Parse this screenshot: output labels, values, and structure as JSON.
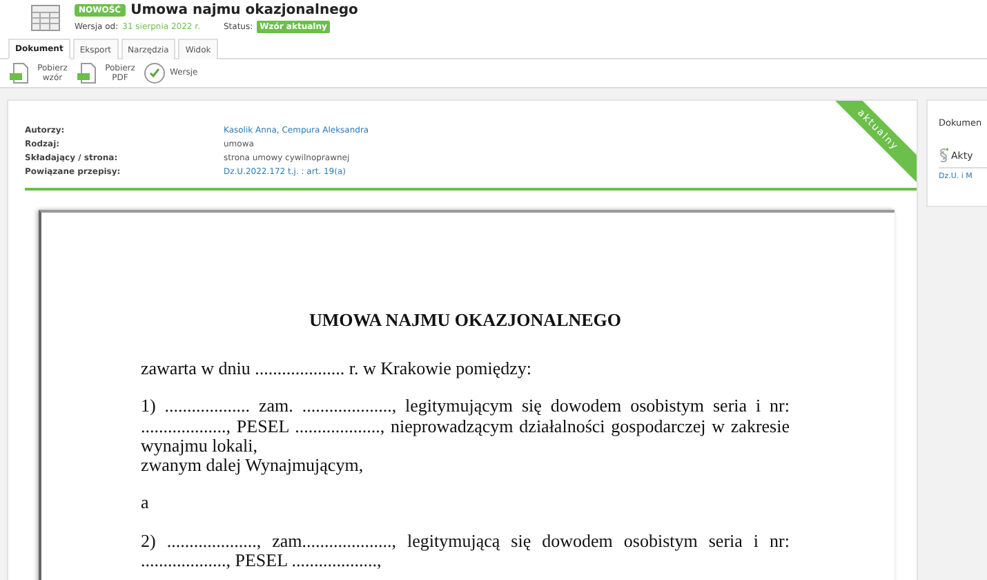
{
  "header": {
    "badge": "NOWOŚĆ",
    "title": "Umowa najmu okazjonalnego",
    "version_label": "Wersja od:",
    "version_date": "31 sierpnia 2022 r.",
    "status_label": "Status:",
    "status": "Wzór aktualny"
  },
  "tabs": [
    {
      "label": "Dokument",
      "selected": true
    },
    {
      "label": "Eksport",
      "selected": false
    },
    {
      "label": "Narzędzia",
      "selected": false
    },
    {
      "label": "Widok",
      "selected": false
    }
  ],
  "toolbar": [
    {
      "kind": "download",
      "label": "Pobierz wzór"
    },
    {
      "kind": "download",
      "label": "Pobierz PDF"
    },
    {
      "kind": "versions",
      "label": "Wersje"
    }
  ],
  "meta": [
    {
      "label": "Autorzy:",
      "value": "Kasolik Anna, Cempura Aleksandra",
      "kind": "link"
    },
    {
      "label": "Rodzaj:",
      "value": "umowa",
      "kind": "text"
    },
    {
      "label": "Składający / strona:",
      "value": "strona umowy cywilnoprawnej",
      "kind": "text"
    },
    {
      "label": "Powiązane przepisy:",
      "value": "Dz.U.2022.172 t.j. : art. 19(a)",
      "kind": "link"
    }
  ],
  "ribbon": "aktualny",
  "side_panel": {
    "title": "Dokumen",
    "section": "Akty",
    "link": "Dz.U. i M"
  },
  "document": {
    "title": "UMOWA NAJMU OKAZJONALNEGO",
    "paragraphs": [
      [
        "zawarta w dniu .................... r. w Krakowie pomiędzy:"
      ],
      [
        "1) ................... zam. ...................., legitymującym się dowodem osobistym seria i nr: ..................., PESEL ..................., nieprowadzącym działalności gospodarczej w zakresie wynajmu lokali,",
        "zwanym dalej Wynajmującym,"
      ],
      [
        "a"
      ],
      [
        "2) ...................., zam...................., legitymującą się dowodem osobistym seria i nr: ..................., PESEL ...................,"
      ]
    ]
  }
}
